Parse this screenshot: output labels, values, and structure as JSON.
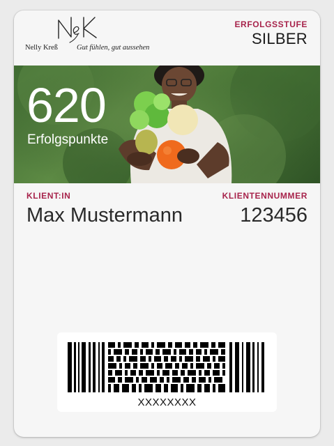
{
  "logo": {
    "monogram": "NeK",
    "name": "Nelly Kreß",
    "slogan": "Gut fühlen, gut aussehen"
  },
  "header": {
    "tier_label": "ERFOLGSSTUFE",
    "tier_value": "SILBER"
  },
  "strip": {
    "points_value": "620",
    "points_label": "Erfolgspunkte"
  },
  "fields": {
    "client_label": "KLIENT:IN",
    "client_value": "Max Mustermann",
    "number_label": "KLIENTENNUMMER",
    "number_value": "123456"
  },
  "barcode": {
    "text": "XXXXXXXX"
  },
  "colors": {
    "accent": "#a7234b",
    "card": "#f6f6f6",
    "background": "#ebebeb"
  }
}
